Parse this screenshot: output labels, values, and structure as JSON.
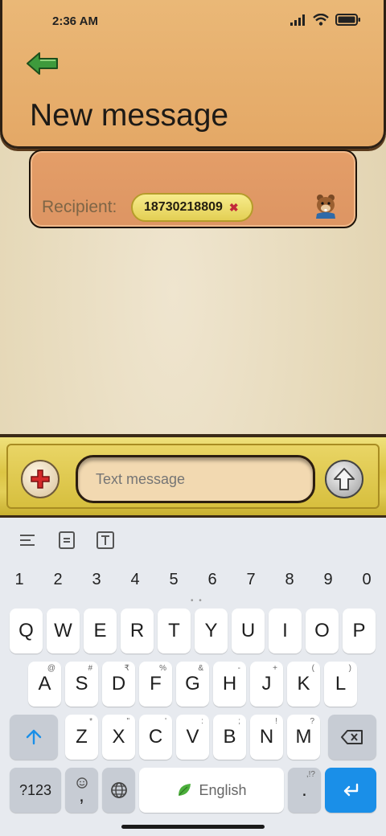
{
  "status_bar": {
    "time": "2:36 AM"
  },
  "header": {
    "title": "New message"
  },
  "recipient": {
    "label": "Recipient:",
    "chip_number": "18730218809",
    "chip_remove": "✖"
  },
  "composer": {
    "placeholder": "Text message"
  },
  "keyboard": {
    "numbers": [
      "1",
      "2",
      "3",
      "4",
      "5",
      "6",
      "7",
      "8",
      "9",
      "0"
    ],
    "row1": [
      "Q",
      "W",
      "E",
      "R",
      "T",
      "Y",
      "U",
      "I",
      "O",
      "P"
    ],
    "row2": [
      {
        "k": "A",
        "h": "@"
      },
      {
        "k": "S",
        "h": "#"
      },
      {
        "k": "D",
        "h": "₹"
      },
      {
        "k": "F",
        "h": "%"
      },
      {
        "k": "G",
        "h": "&"
      },
      {
        "k": "H",
        "h": "-"
      },
      {
        "k": "J",
        "h": "+"
      },
      {
        "k": "K",
        "h": "("
      },
      {
        "k": "L",
        "h": ")"
      }
    ],
    "row3": [
      {
        "k": "Z",
        "h": "*"
      },
      {
        "k": "X",
        "h": "\""
      },
      {
        "k": "C",
        "h": "'"
      },
      {
        "k": "V",
        "h": ":"
      },
      {
        "k": "B",
        "h": ";"
      },
      {
        "k": "N",
        "h": "!"
      },
      {
        "k": "M",
        "h": "?"
      }
    ],
    "symbols_label": "?123",
    "comma_label": ",",
    "space_label": "English",
    "period_label": ".",
    "period_hint": ",!?"
  },
  "colors": {
    "header_bg": "#e6ad6c",
    "recipient_bg": "#e09a65",
    "chip_bg": "#f0df72",
    "composer_bg": "#dcc544",
    "keyboard_bg": "#e7eaef",
    "enter_key": "#1a8fe8"
  },
  "icons": [
    "back-arrow-icon",
    "signal-icon",
    "wifi-icon",
    "battery-icon",
    "beaver-avatar-icon",
    "plus-icon",
    "send-arrow-icon",
    "cursor-move-icon",
    "select-text-icon",
    "text-format-icon",
    "shift-icon",
    "backspace-icon",
    "emoji-icon",
    "globe-icon",
    "leaf-icon",
    "enter-icon"
  ]
}
